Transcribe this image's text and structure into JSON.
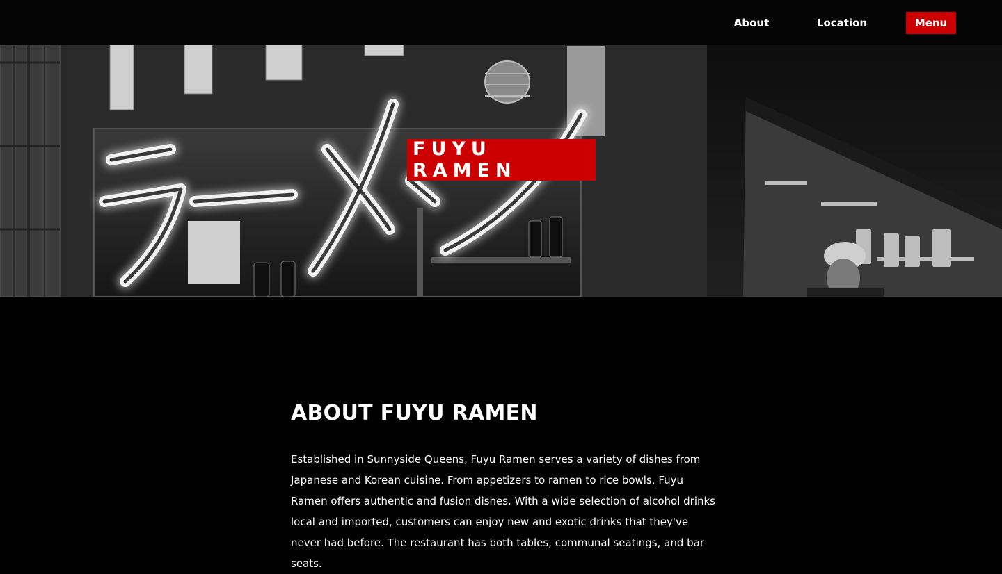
{
  "nav": {
    "about_label": "About",
    "location_label": "Location",
    "menu_label": "Menu"
  },
  "hero": {
    "title": "FUYU RAMEN",
    "neon_sign_text": "ラーメン",
    "image_description_icon": "restaurant-photo"
  },
  "about": {
    "heading": "ABOUT FUYU RAMEN",
    "body": "Established in Sunnyside Queens, Fuyu Ramen serves a variety of dishes from Japanese and Korean cuisine. From appetizers to ramen to rice bowls, Fuyu Ramen offers authentic and fusion dishes. With a wide selection of alcohol drinks local and imported, customers can enjoy new and exotic drinks that they've never had before. The restaurant has both tables, communal seatings, and bar seats."
  },
  "colors": {
    "accent": "#cc0000",
    "background": "#000000",
    "text": "#ffffff"
  }
}
